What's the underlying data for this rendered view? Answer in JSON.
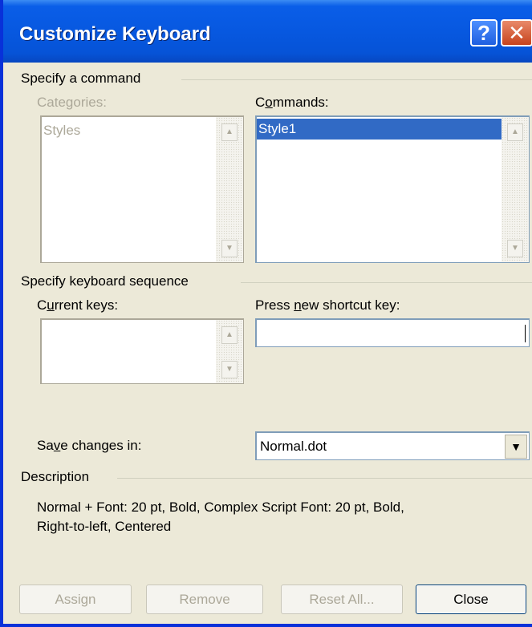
{
  "window": {
    "title": "Customize Keyboard",
    "help_label": "?",
    "close_label": "✕"
  },
  "specify_command": {
    "group_label": "Specify a command",
    "categories_label": "Categories:",
    "categories": [
      "Styles"
    ],
    "commands_label_pre": "C",
    "commands_label_accel": "o",
    "commands_label_post": "mmands:",
    "commands": [
      "Style1"
    ],
    "selected_command": "Style1"
  },
  "keyboard_sequence": {
    "group_label": "Specify keyboard sequence",
    "current_keys_pre": "C",
    "current_keys_accel": "u",
    "current_keys_post": "rrent keys:",
    "current_keys": [],
    "new_shortcut_pre": "Press ",
    "new_shortcut_accel": "n",
    "new_shortcut_post": "ew shortcut key:",
    "new_shortcut_value": ""
  },
  "save_changes": {
    "label_pre": "Sa",
    "label_accel": "v",
    "label_post": "e changes in:",
    "value": "Normal.dot"
  },
  "description": {
    "group_label": "Description",
    "line1": "Normal + Font: 20 pt, Bold, Complex Script Font: 20 pt, Bold,",
    "line2": "Right-to-left, Centered"
  },
  "buttons": {
    "assign": "Assign",
    "remove": "Remove",
    "reset_all": "Reset All...",
    "close": "Close"
  },
  "icons": {
    "scroll_up": "▲",
    "scroll_down": "▼",
    "dropdown": "▼"
  },
  "colors": {
    "titlebar": "#0A5EE8",
    "dialog_bg": "#ECE9D8",
    "selection": "#316AC5",
    "disabled_text": "#ACA899"
  }
}
